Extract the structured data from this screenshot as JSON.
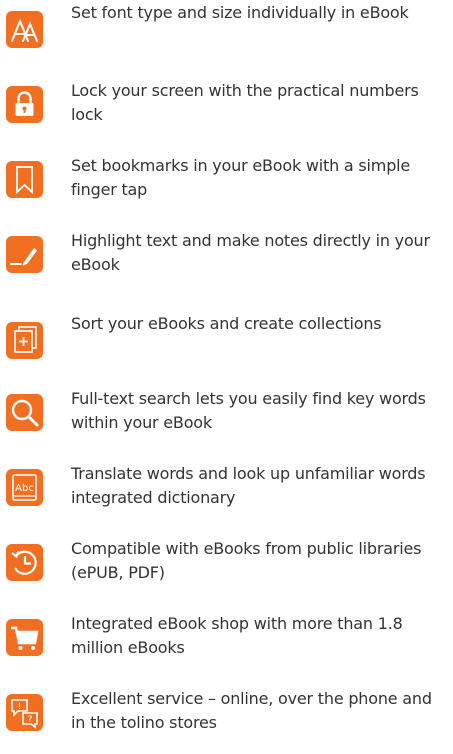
{
  "accent_color": "#f26f22",
  "features": [
    {
      "icon": "font-size-icon",
      "text": "Set font type and size individually in eBook"
    },
    {
      "icon": "lock-icon",
      "text": "Lock your screen with the practical numbers lock"
    },
    {
      "icon": "bookmark-icon",
      "text": "Set bookmarks in your eBook with a simple finger tap"
    },
    {
      "icon": "highlight-pen-icon",
      "text": "Highlight text and make notes directly in your eBook"
    },
    {
      "icon": "collections-icon",
      "text": "Sort your eBooks and create collections"
    },
    {
      "icon": "search-icon",
      "text": "Full-text search lets you easily find key words within your eBook"
    },
    {
      "icon": "dictionary-icon",
      "text": "Translate words and look up unfamiliar words integrated dictionary"
    },
    {
      "icon": "history-clock-icon",
      "text": "Compatible with eBooks from public libraries (ePUB, PDF)"
    },
    {
      "icon": "shopping-cart-icon",
      "text": "Integrated eBook shop with more than 1.8 million eBooks"
    },
    {
      "icon": "support-chat-icon",
      "text": "Excellent service – online, over the phone and in the tolino stores"
    }
  ]
}
